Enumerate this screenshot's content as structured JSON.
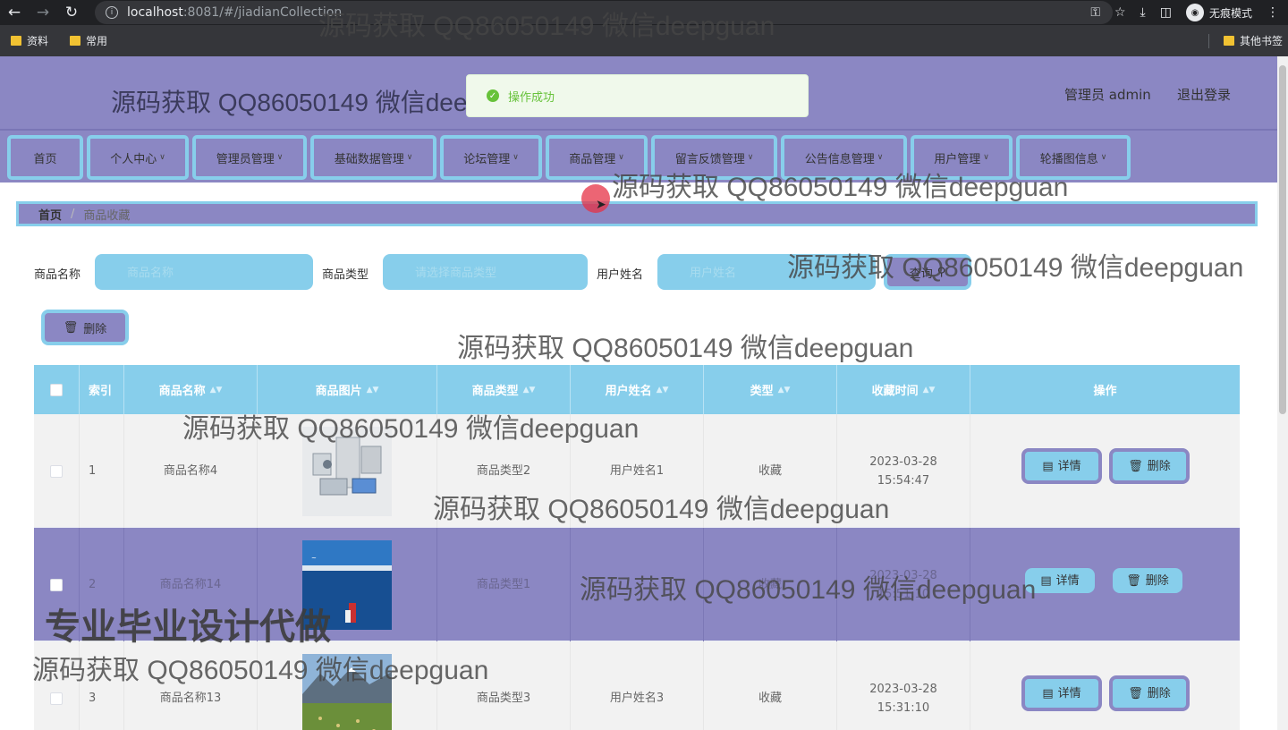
{
  "browser": {
    "url_host": "localhost",
    "url_path": ":8081/#/jiadianCollection",
    "incognito_label": "无痕模式",
    "bookmarks": [
      "资料",
      "常用"
    ],
    "other_bookmarks": "其他书签"
  },
  "header": {
    "title": "源码获取 QQ86050149 微信deepguan",
    "user": "管理员 admin",
    "logout": "退出登录"
  },
  "toast": {
    "message": "操作成功"
  },
  "menu": [
    "首页",
    "个人中心",
    "管理员管理",
    "基础数据管理",
    "论坛管理",
    "商品管理",
    "留言反馈管理",
    "公告信息管理",
    "用户管理",
    "轮播图信息"
  ],
  "breadcrumb": {
    "home": "首页",
    "current": "商品收藏"
  },
  "search": {
    "labels": [
      "商品名称",
      "商品类型",
      "用户姓名"
    ],
    "placeholders": [
      "商品名称",
      "请选择商品类型",
      "用户姓名"
    ],
    "query_button": "查询",
    "delete_button": "删除"
  },
  "table": {
    "headers": [
      "索引",
      "商品名称",
      "商品图片",
      "商品类型",
      "用户姓名",
      "类型",
      "收藏时间",
      "操作"
    ],
    "rows": [
      {
        "index": "1",
        "name": "商品名称4",
        "type": "商品类型2",
        "user": "用户姓名1",
        "kind": "收藏",
        "time": "2023-03-28 15:54:47"
      },
      {
        "index": "2",
        "name": "商品名称14",
        "type": "商品类型1",
        "user": "",
        "kind": "收藏",
        "time": "2023-03-28 15:51:10"
      },
      {
        "index": "3",
        "name": "商品名称13",
        "type": "商品类型3",
        "user": "用户姓名3",
        "kind": "收藏",
        "time": "2023-03-28 15:31:10"
      }
    ],
    "detail_button": "详情",
    "delete_button": "删除"
  },
  "watermarks": {
    "text": "源码获取 QQ86050149 微信deepguan",
    "big": "专业毕业设计代做"
  }
}
